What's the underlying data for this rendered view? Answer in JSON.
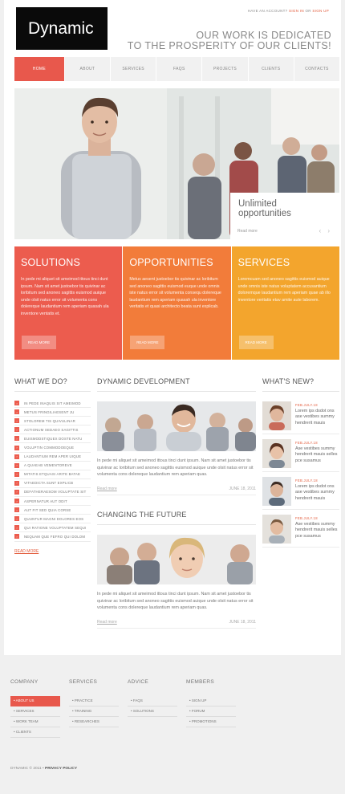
{
  "brand": {
    "logo": "Dynamic"
  },
  "account": {
    "prefix": "HAVE AN ACCOUNT?",
    "sign_in": "SIGN IN",
    "or": "OR",
    "sign_up": "SIGN UP"
  },
  "slogan": {
    "line1": "OUR WORK IS DEDICATED",
    "line2": "TO THE PROSPERITY OF OUR CLIENTS!"
  },
  "nav": [
    "HOME",
    "ABOUT",
    "SERVICES",
    "FAQS",
    "PROJECTS",
    "CLIENTS",
    "CONTACTS"
  ],
  "hero": {
    "title_line1": "Unlimited",
    "title_line2": "opportunities",
    "read_more": "Read more",
    "arrows": "‹ ›"
  },
  "panels": [
    {
      "title": "SOLUTIONS",
      "text": "In pede mi aliquet sit ameimod ittous tinci dunt ipsum. Nam sit amet justoebor tis quivinar ac loribitum sed anoneo sagittis euismod auique unde olsit natus error sit volumenta cons dolereque laudantium rem aperiam quasah ula inventore ventatis et.",
      "button": "READ MORE"
    },
    {
      "title": "OPPORTUNITIES",
      "text": "Metus aesent justoebor tis quivinar ac loribitum sed anoneo sagittis euismod euque unde omnis iste natus error sit volumenta consequ dolereque laudantium rem aperiam quasah ula inventore veritatis et quasi architecto beata sunt explicab.",
      "button": "READ MORE"
    },
    {
      "title": "SERVICES",
      "text": "Loremcuam sed anoneo sagittis euismod auique unde omnis iste natus voluptatem accusantium doloremque laudantium rem aperiam quae ab illo inventore veritatis etav amite aute laborem.",
      "button": "READ MORE"
    }
  ],
  "what_we_do": {
    "title": "WHAT WE DO?",
    "items": [
      "IN PEDE INAQUIS SIT AMEIMOD",
      "METUS FRINGILIAESENT JU",
      "STOLOREM TIS QUIVULINAR",
      "ACTIONUM SEDAEO SAGITTIS",
      "EUISMODSTIQUEX DOSTE NATU",
      "VOLUPTIN COMMODOEQUE",
      "LAUDANTIUM REM APER UIQUE",
      "A QUAEAB VEMENTOREVE",
      "MITATIS ETQUASI ARITE BATAE",
      "VITAEDICTA SUNT EXPLICB",
      "DEFATHERAESOM VOLUPTATE SIT",
      "ASPERNATUR AUT ODIT",
      "AUT FIT SED QUIA CORSE",
      "QUUNTUR MAGNI DOLORES EOS",
      "QUI RATIONE VOLUPTATEM SEQUI",
      "NEQUAM QUE FEFRO QUI DOLOM"
    ],
    "read_more": "READ MORE"
  },
  "articles": [
    {
      "title": "DYNAMIC DEVELOPMENT",
      "text": "In pede mi aliquet sit ameimod ittous tinci dunt ipsum. Nam sit amet justoebor tis quivinar ac loribitum sed anoneo sagittis euismod auique unde olsit natus error sit volumenta cons dolereque laudantium rem aperiam quas.",
      "read_more": "Read more",
      "date": "JUNE 18, 2011"
    },
    {
      "title": "CHANGING THE FUTURE",
      "text": "In pede mi aliquet sit ameimod ittous tinci dunt ipsum. Nam sit amet justoebor tis quivinar ac loribitum sed anoneo sagittis euismod auique unde olsit natus error sit volumenta cons dolereque laudantium rem aperiam quas.",
      "read_more": "Read more",
      "date": "JUNE 18, 2011"
    }
  ],
  "news": {
    "title": "WHAT'S NEW?",
    "items": [
      {
        "date": "FEB.JULY.18",
        "text": "Lorem ips dsdot ons ase vestibes summy hendrerit mauis"
      },
      {
        "date": "FEB.JULY.18",
        "text": "Ase vestibes summy hendrerit mauis selles pce susamus"
      },
      {
        "date": "FEB.JULY.18",
        "text": "Lorem ips dsdot ons ase vestibes summy hendrerit mauis"
      },
      {
        "date": "FEB.JULY.18",
        "text": "Ase vestibes summy hendrerit mauis selles pce susamus"
      }
    ]
  },
  "footer": {
    "columns": [
      {
        "title": "COMPANY",
        "items": [
          "ABOUT US",
          "SERVICES",
          "WORK TEAM",
          "CLIENTS"
        ]
      },
      {
        "title": "SERVICES",
        "items": [
          "PRACTICE",
          "TRAINING",
          "RESEARCHES"
        ]
      },
      {
        "title": "ADVICE",
        "items": [
          "FAQS",
          "SOLUTIONS"
        ]
      },
      {
        "title": "MEMBERS",
        "items": [
          "SIGN UP",
          "FORUM",
          "PROMOTIONS"
        ]
      }
    ],
    "copyright": "DYNAMIC © 2011 •",
    "privacy": "PRIVACY POLICY"
  },
  "colors": {
    "accent": "#e8584c",
    "orange": "#f27c3a",
    "amber": "#f3a52d",
    "logo_bg": "#0a0a0a"
  }
}
